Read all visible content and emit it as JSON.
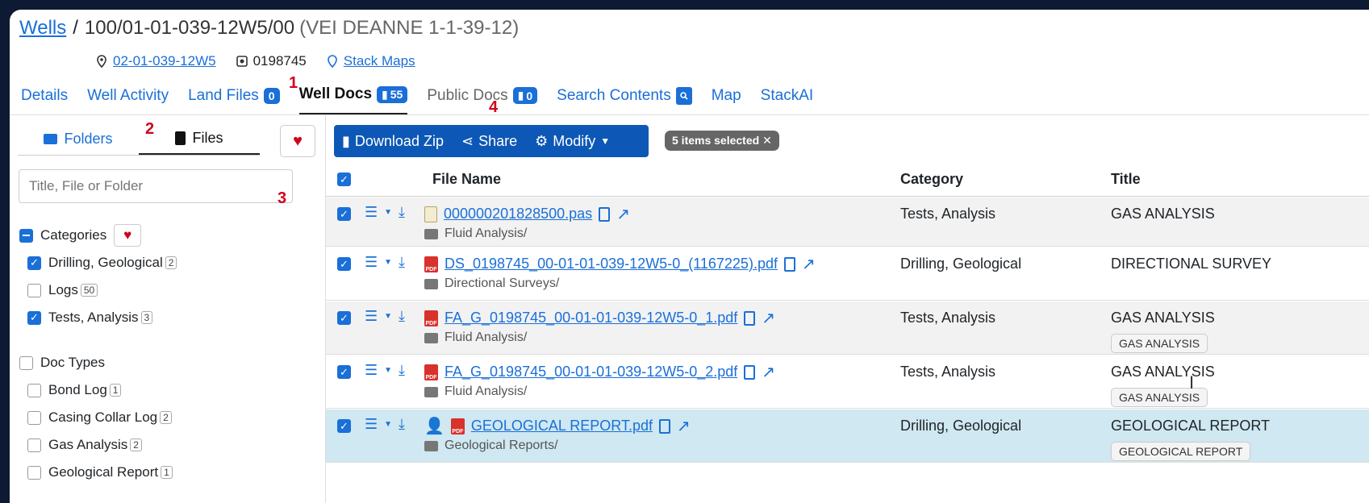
{
  "header": {
    "breadcrumb_root": "Wells",
    "separator": "/",
    "well_id": "100/01-01-039-12W5/00",
    "well_name": "(VEI DEANNE 1-1-39-12)",
    "location_link": "02-01-039-12W5",
    "license": "0198745",
    "stack_maps": "Stack Maps"
  },
  "tabs": [
    {
      "label": "Details"
    },
    {
      "label": "Well Activity"
    },
    {
      "label": "Land Files",
      "count": "0"
    },
    {
      "label": "Well Docs",
      "count": "55"
    },
    {
      "label": "Public Docs",
      "count": "0"
    },
    {
      "label": "Search Contents"
    },
    {
      "label": "Map"
    },
    {
      "label": "StackAI"
    }
  ],
  "annotations": {
    "a1": "1",
    "a2": "2",
    "a3": "3",
    "a4": "4"
  },
  "sidebar": {
    "folders_tab": "Folders",
    "files_tab": "Files",
    "search_placeholder": "Title, File or Folder",
    "categories_label": "Categories",
    "categories": [
      {
        "label": "Drilling, Geological",
        "count": "2",
        "checked": true
      },
      {
        "label": "Logs",
        "count": "50",
        "checked": false
      },
      {
        "label": "Tests, Analysis",
        "count": "3",
        "checked": true
      }
    ],
    "doc_types_label": "Doc Types",
    "doc_types": [
      {
        "label": "Bond Log",
        "count": "1"
      },
      {
        "label": "Casing Collar Log",
        "count": "2"
      },
      {
        "label": "Gas Analysis",
        "count": "2"
      },
      {
        "label": "Geological Report",
        "count": "1"
      }
    ]
  },
  "toolbar": {
    "download": "Download Zip",
    "share": "Share",
    "modify": "Modify",
    "selected": "5 items selected"
  },
  "table": {
    "headers": {
      "file": "File Name",
      "category": "Category",
      "title": "Title"
    },
    "rows": [
      {
        "file": "000000201828500.pas",
        "folder": "Fluid Analysis/",
        "category": "Tests, Analysis",
        "title": "GAS ANALYSIS",
        "tag": ""
      },
      {
        "file": "DS_0198745_00-01-01-039-12W5-0_(1167225).pdf",
        "folder": "Directional Surveys/",
        "category": "Drilling, Geological",
        "title": "DIRECTIONAL SURVEY",
        "tag": ""
      },
      {
        "file": "FA_G_0198745_00-01-01-039-12W5-0_1.pdf",
        "folder": "Fluid Analysis/",
        "category": "Tests, Analysis",
        "title": "GAS ANALYSIS",
        "tag": "GAS ANALYSIS"
      },
      {
        "file": "FA_G_0198745_00-01-01-039-12W5-0_2.pdf",
        "folder": "Fluid Analysis/",
        "category": "Tests, Analysis",
        "title": "GAS ANALYSIS",
        "tag": "GAS ANALYSIS"
      },
      {
        "file": "GEOLOGICAL REPORT.pdf",
        "folder": "Geological Reports/",
        "category": "Drilling, Geological",
        "title": "GEOLOGICAL REPORT",
        "tag": "GEOLOGICAL REPORT"
      }
    ]
  }
}
